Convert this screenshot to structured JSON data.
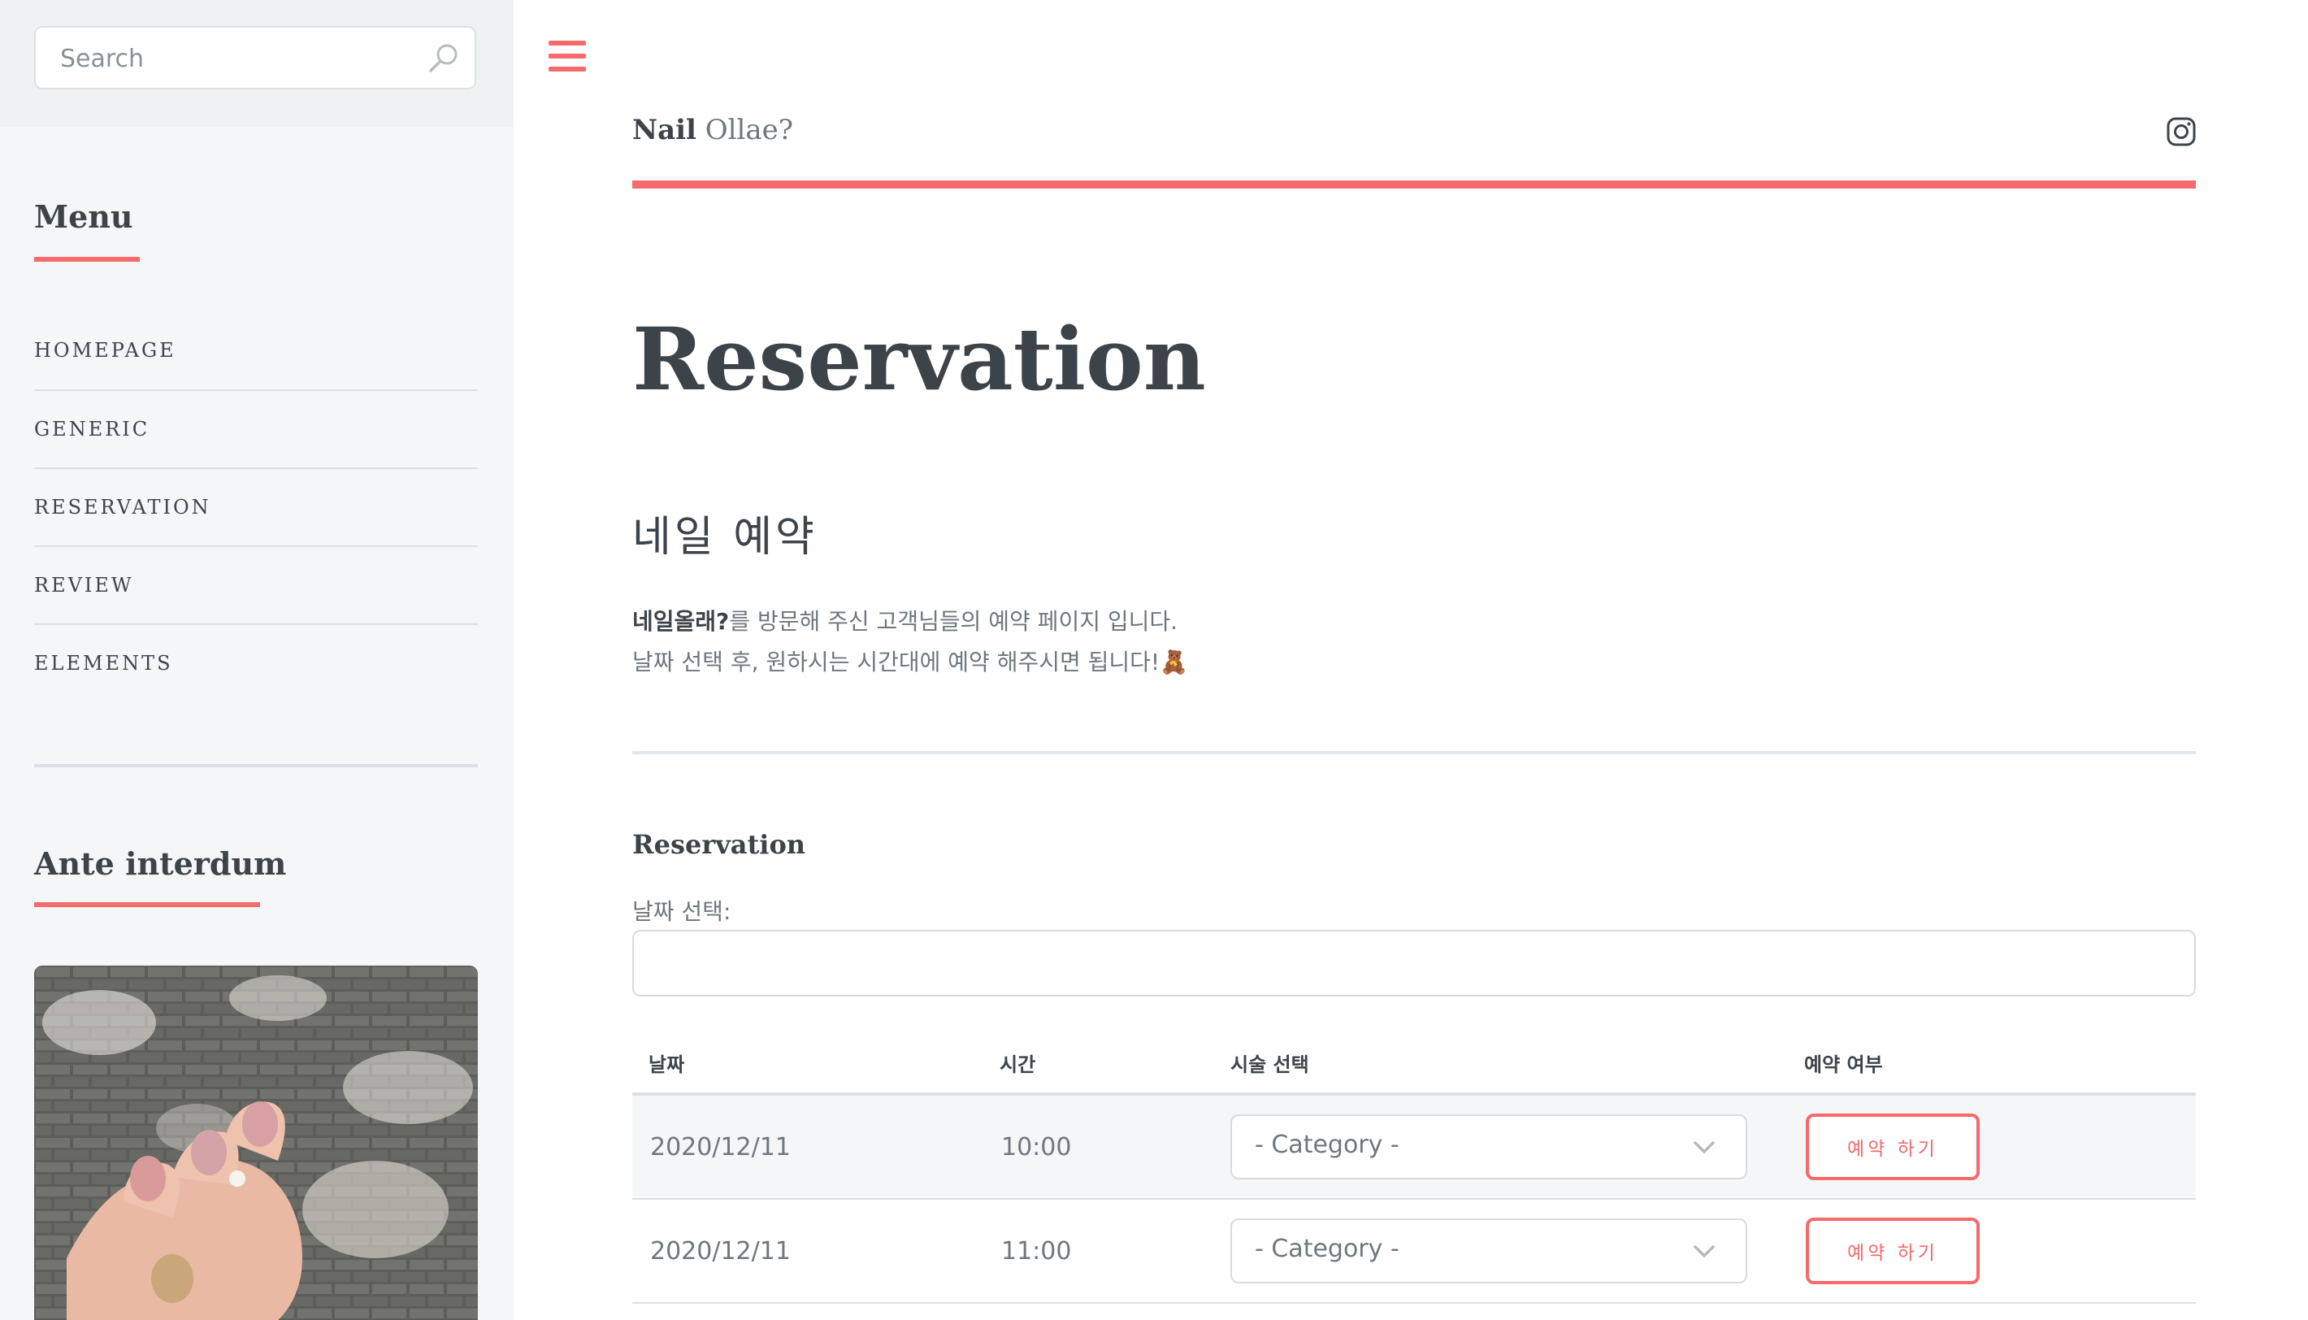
{
  "search": {
    "placeholder": "Search"
  },
  "sidebar": {
    "menu_title": "Menu",
    "menu_items": [
      {
        "label": "HOMEPAGE"
      },
      {
        "label": "GENERIC"
      },
      {
        "label": "RESERVATION"
      },
      {
        "label": "REVIEW"
      },
      {
        "label": "ELEMENTS"
      }
    ],
    "feature_title": "Ante interdum"
  },
  "header": {
    "logo_bold": "Nail",
    "logo_rest": "Ollae?"
  },
  "main": {
    "page_title": "Reservation",
    "section_title": "네일 예약",
    "intro_bold": "네일올래?",
    "intro_line1_rest": "를 방문해 주신 고객님들의 예약 페이지 입니다.",
    "intro_line2": "날짜 선택 후, 원하시는 시간대에 예약 해주시면 됩니다!🧸",
    "form_title": "Reservation",
    "date_label": "날짜 선택:",
    "date_value": "",
    "table": {
      "headers": [
        "날짜",
        "시간",
        "시술 선택",
        "예약 여부"
      ],
      "rows": [
        {
          "date": "2020/12/11",
          "time": "10:00",
          "category": "- Category -",
          "button": "예약 하기"
        },
        {
          "date": "2020/12/11",
          "time": "11:00",
          "category": "- Category -",
          "button": "예약 하기"
        }
      ]
    }
  },
  "colors": {
    "accent": "#f56a6a",
    "text": "#3d4449",
    "muted": "#6f777d",
    "sidebar_bg": "#f5f6f7"
  },
  "icons": [
    "search-icon",
    "hamburger-icon",
    "instagram-icon",
    "chevron-down-icon"
  ]
}
